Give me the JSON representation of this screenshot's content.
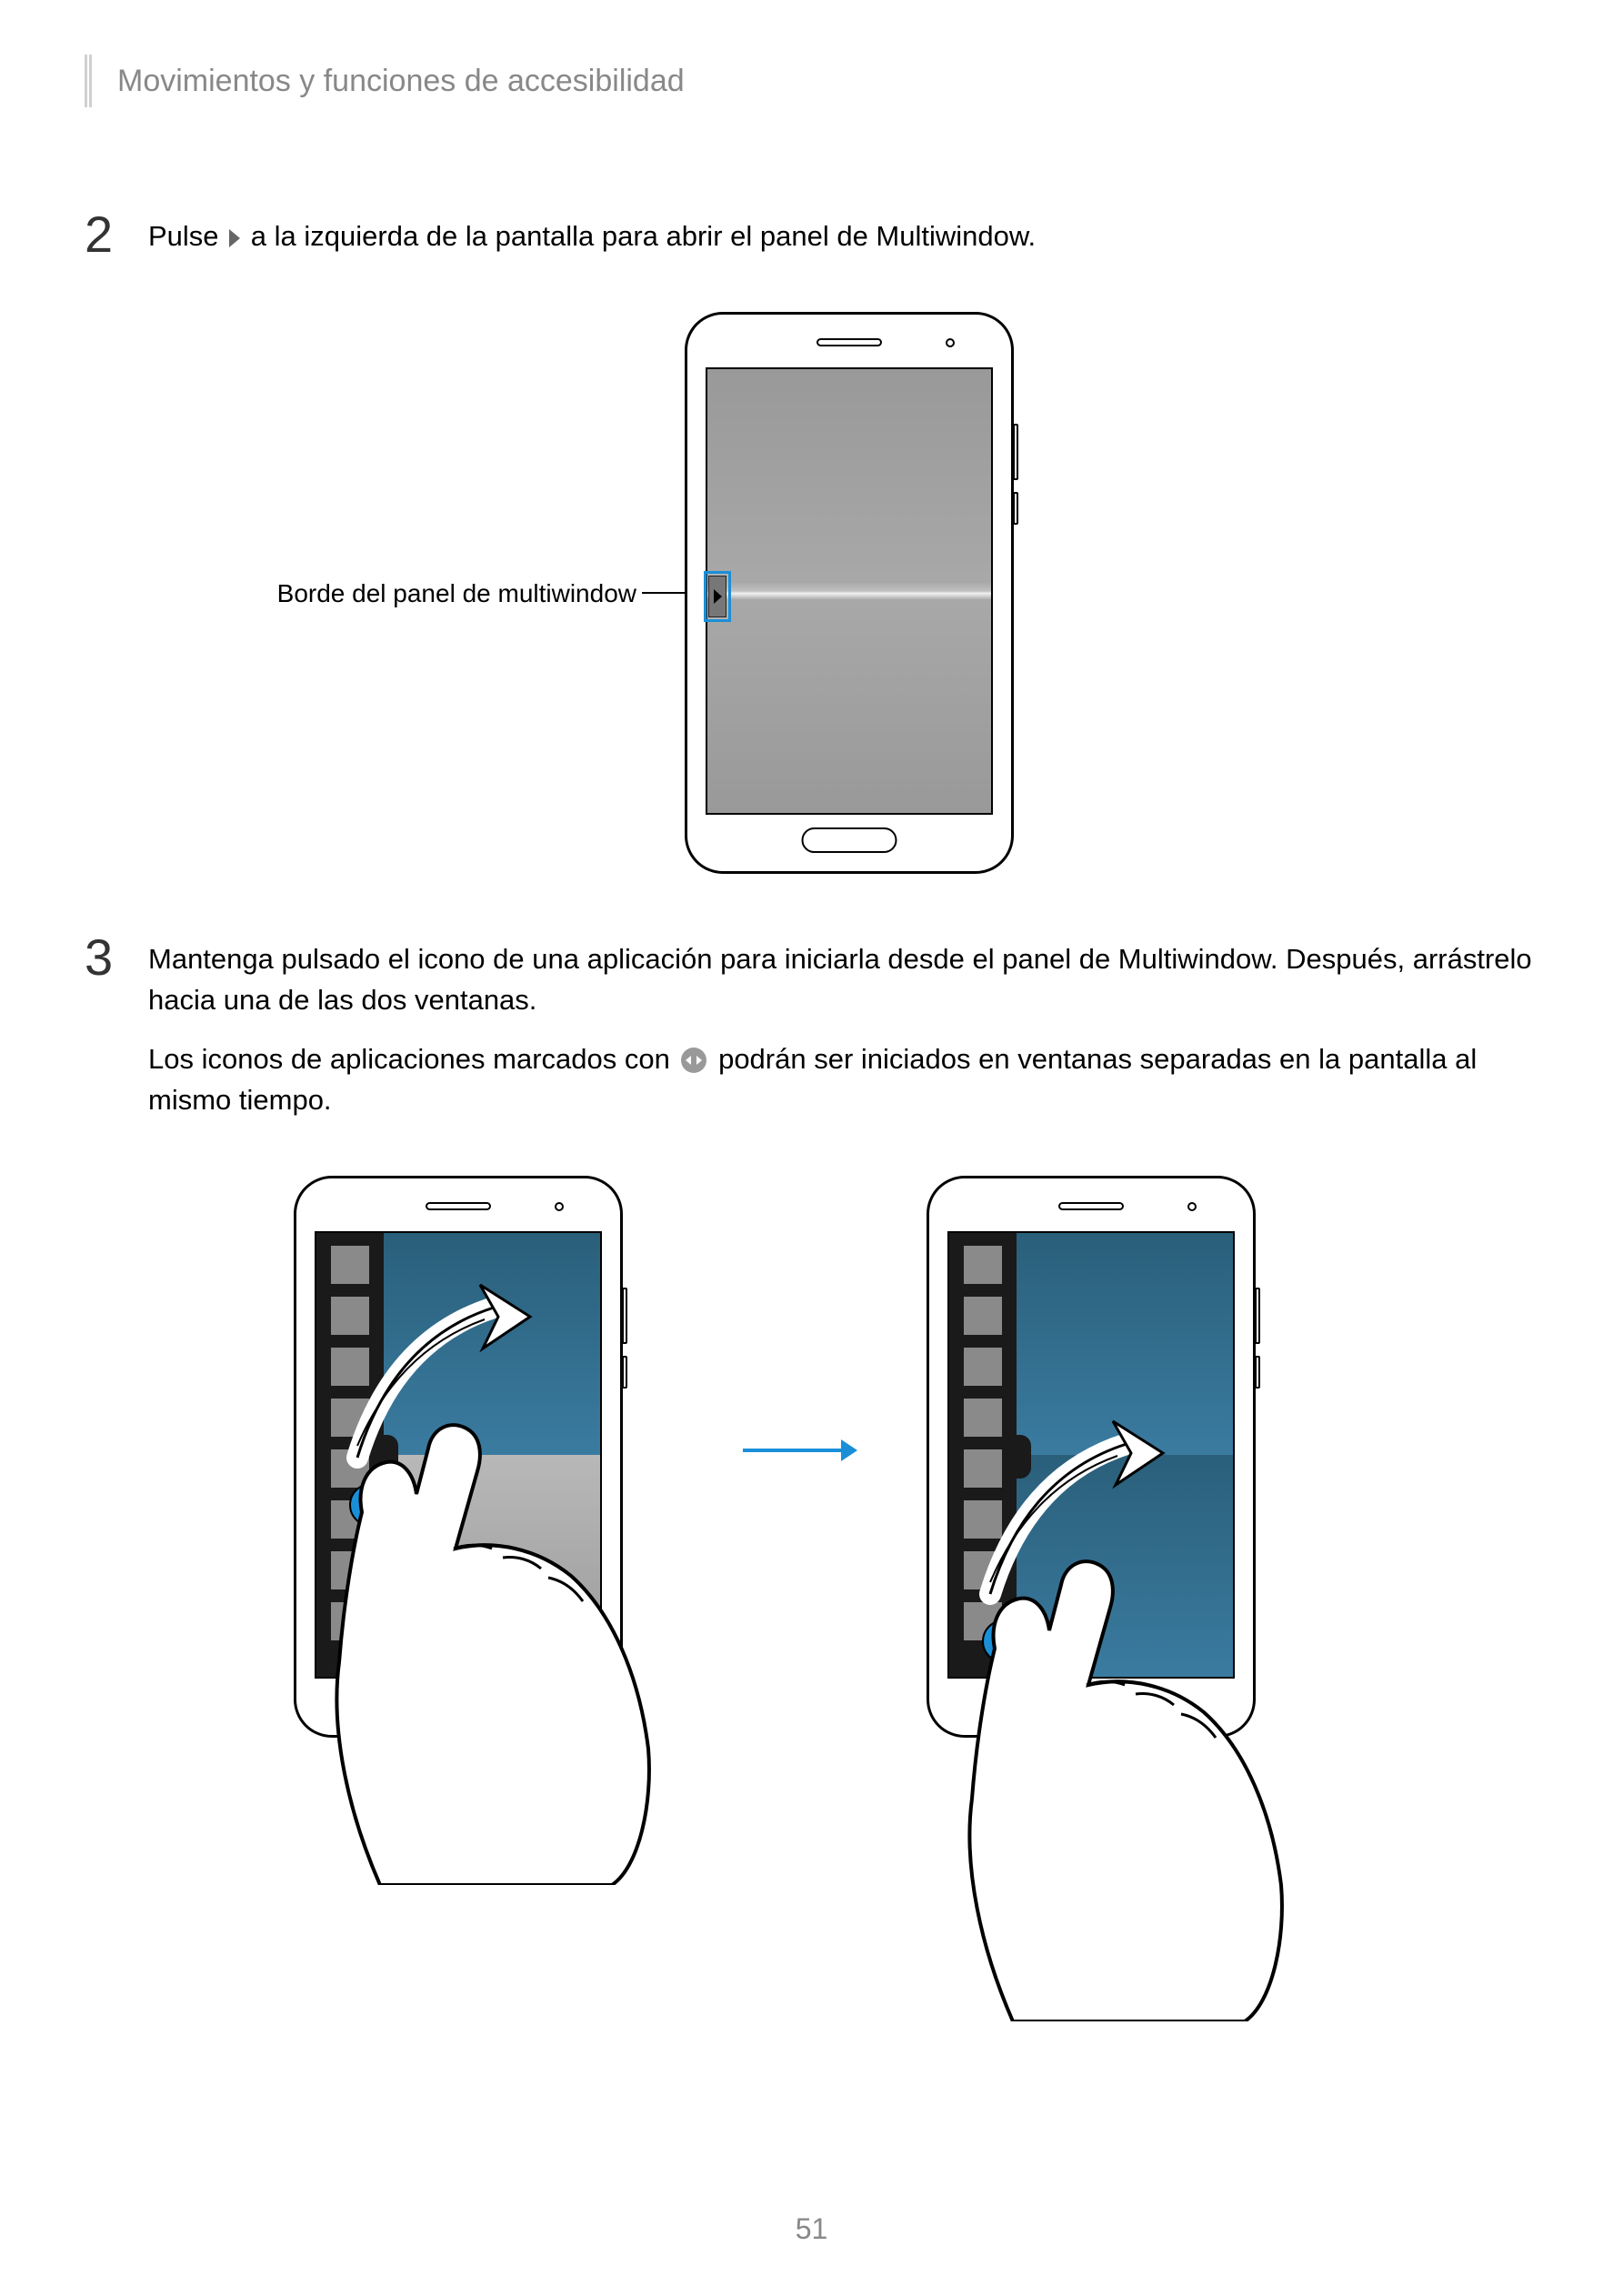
{
  "header": {
    "title": "Movimientos y funciones de accesibilidad"
  },
  "steps": {
    "s2": {
      "num": "2",
      "line1a": "Pulse ",
      "line1b": " a la izquierda de la pantalla para abrir el panel de Multiwindow."
    },
    "s3": {
      "num": "3",
      "p1": "Mantenga pulsado el icono de una aplicación para iniciarla desde el panel de Multiwindow. Después, arrástrelo hacia una de las dos ventanas.",
      "p2a": "Los iconos de aplicaciones marcados con ",
      "p2b": " podrán ser iniciados en ventanas separadas en la pantalla al mismo tiempo."
    }
  },
  "callout": {
    "text": "Borde del panel de multiwindow"
  },
  "page": "51"
}
